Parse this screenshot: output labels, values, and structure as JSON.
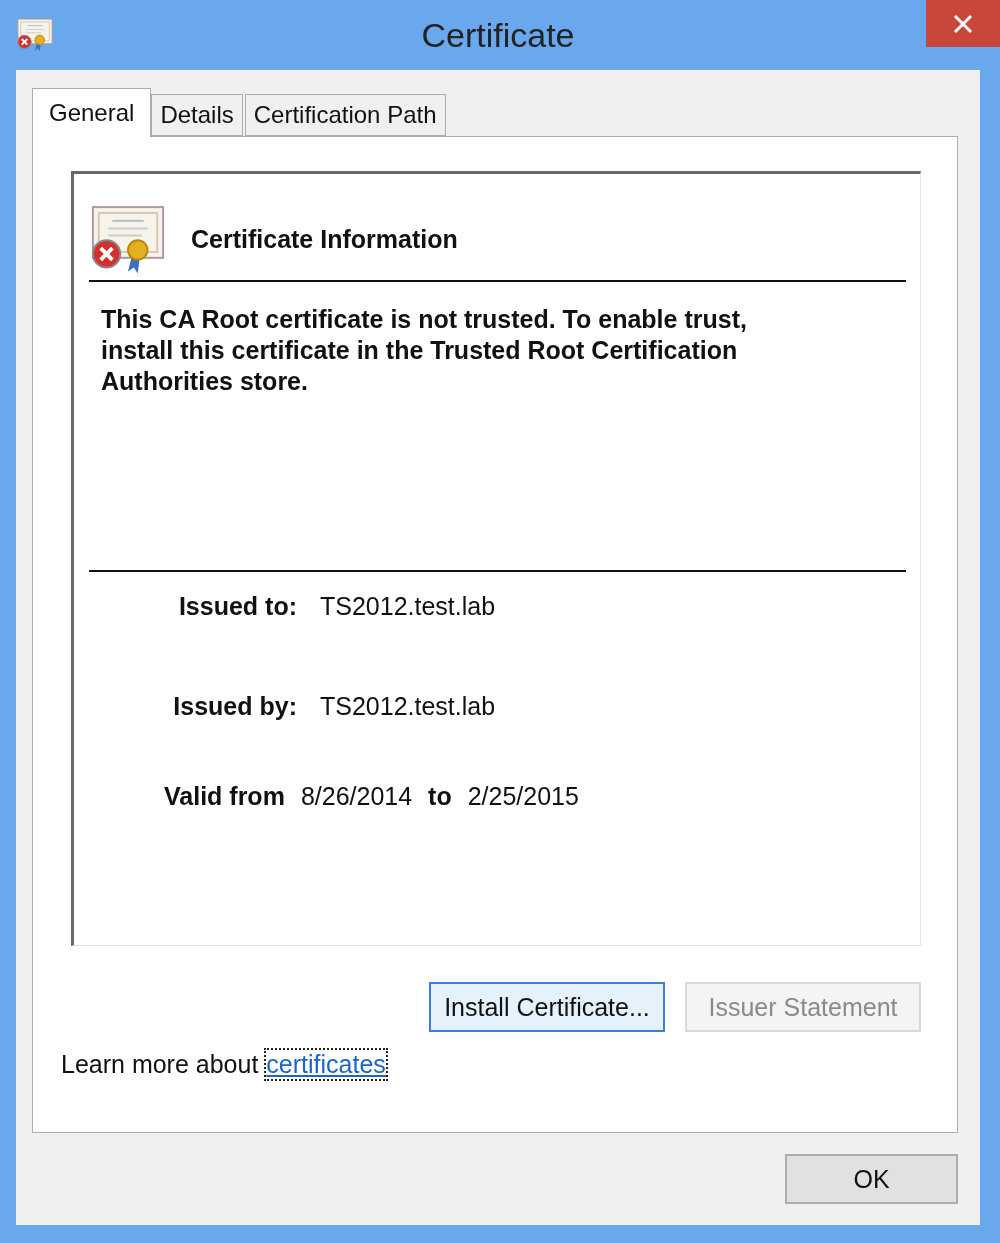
{
  "window": {
    "title": "Certificate"
  },
  "tabs": [
    {
      "label": "General",
      "selected": true
    },
    {
      "label": "Details",
      "selected": false
    },
    {
      "label": "Certification Path",
      "selected": false
    }
  ],
  "panel": {
    "heading": "Certificate Information",
    "message": "This CA Root certificate is not trusted. To enable trust, install this certificate in the Trusted Root Certification Authorities store.",
    "fields": [
      {
        "label": "Issued to:",
        "value": "TS2012.test.lab"
      },
      {
        "label": "Issued by:",
        "value": "TS2012.test.lab"
      }
    ],
    "validity": {
      "from_label": "Valid from",
      "from": "8/26/2014",
      "to_label": "to",
      "to": "2/25/2015"
    }
  },
  "buttons": [
    {
      "label": "Install Certificate...",
      "disabled": false,
      "focused": true
    },
    {
      "label": "Issuer Statement",
      "disabled": true,
      "focused": false
    }
  ],
  "learn_more": {
    "text": "Learn more about",
    "link": "certificates"
  },
  "ok_button": {
    "label": "OK"
  }
}
